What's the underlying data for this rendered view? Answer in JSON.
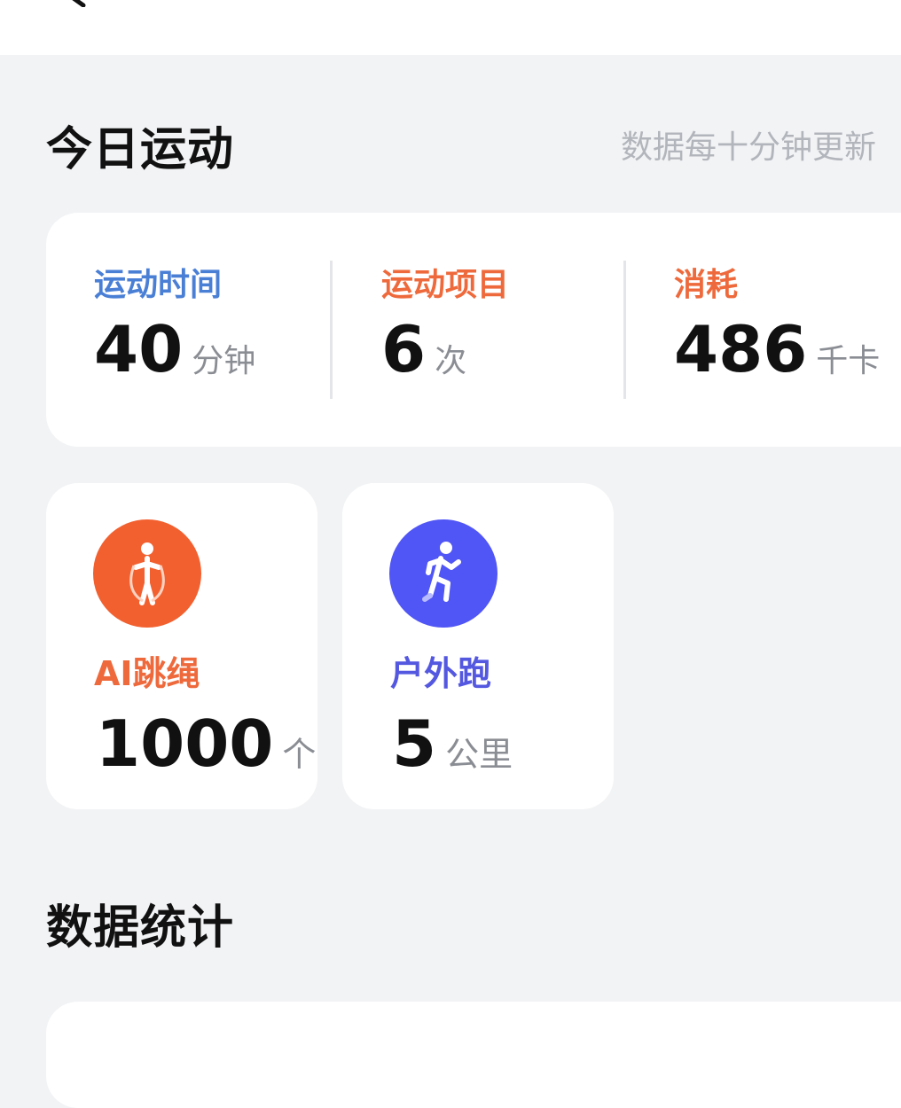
{
  "today": {
    "title": "今日运动",
    "update_hint": "数据每十分钟更新"
  },
  "summary": {
    "time": {
      "label": "运动时间",
      "value": "40",
      "unit": "分钟",
      "color": "#4a7fd6"
    },
    "items": {
      "label": "运动项目",
      "value": "6",
      "unit": "次",
      "color": "#ee6a3c"
    },
    "calories": {
      "label": "消耗",
      "value": "486",
      "unit": "千卡",
      "color": "#ee6a3c"
    }
  },
  "sports": [
    {
      "label": "AI跳绳",
      "value": "1000",
      "unit": "个",
      "icon": "jump-rope-icon",
      "color": "#f2602f",
      "label_color": "#ee6a3c"
    },
    {
      "label": "户外跑",
      "value": "5",
      "unit": "公里",
      "icon": "running-icon",
      "color": "#5055f5",
      "label_color": "#5458e0"
    }
  ],
  "stats": {
    "title": "数据统计"
  }
}
